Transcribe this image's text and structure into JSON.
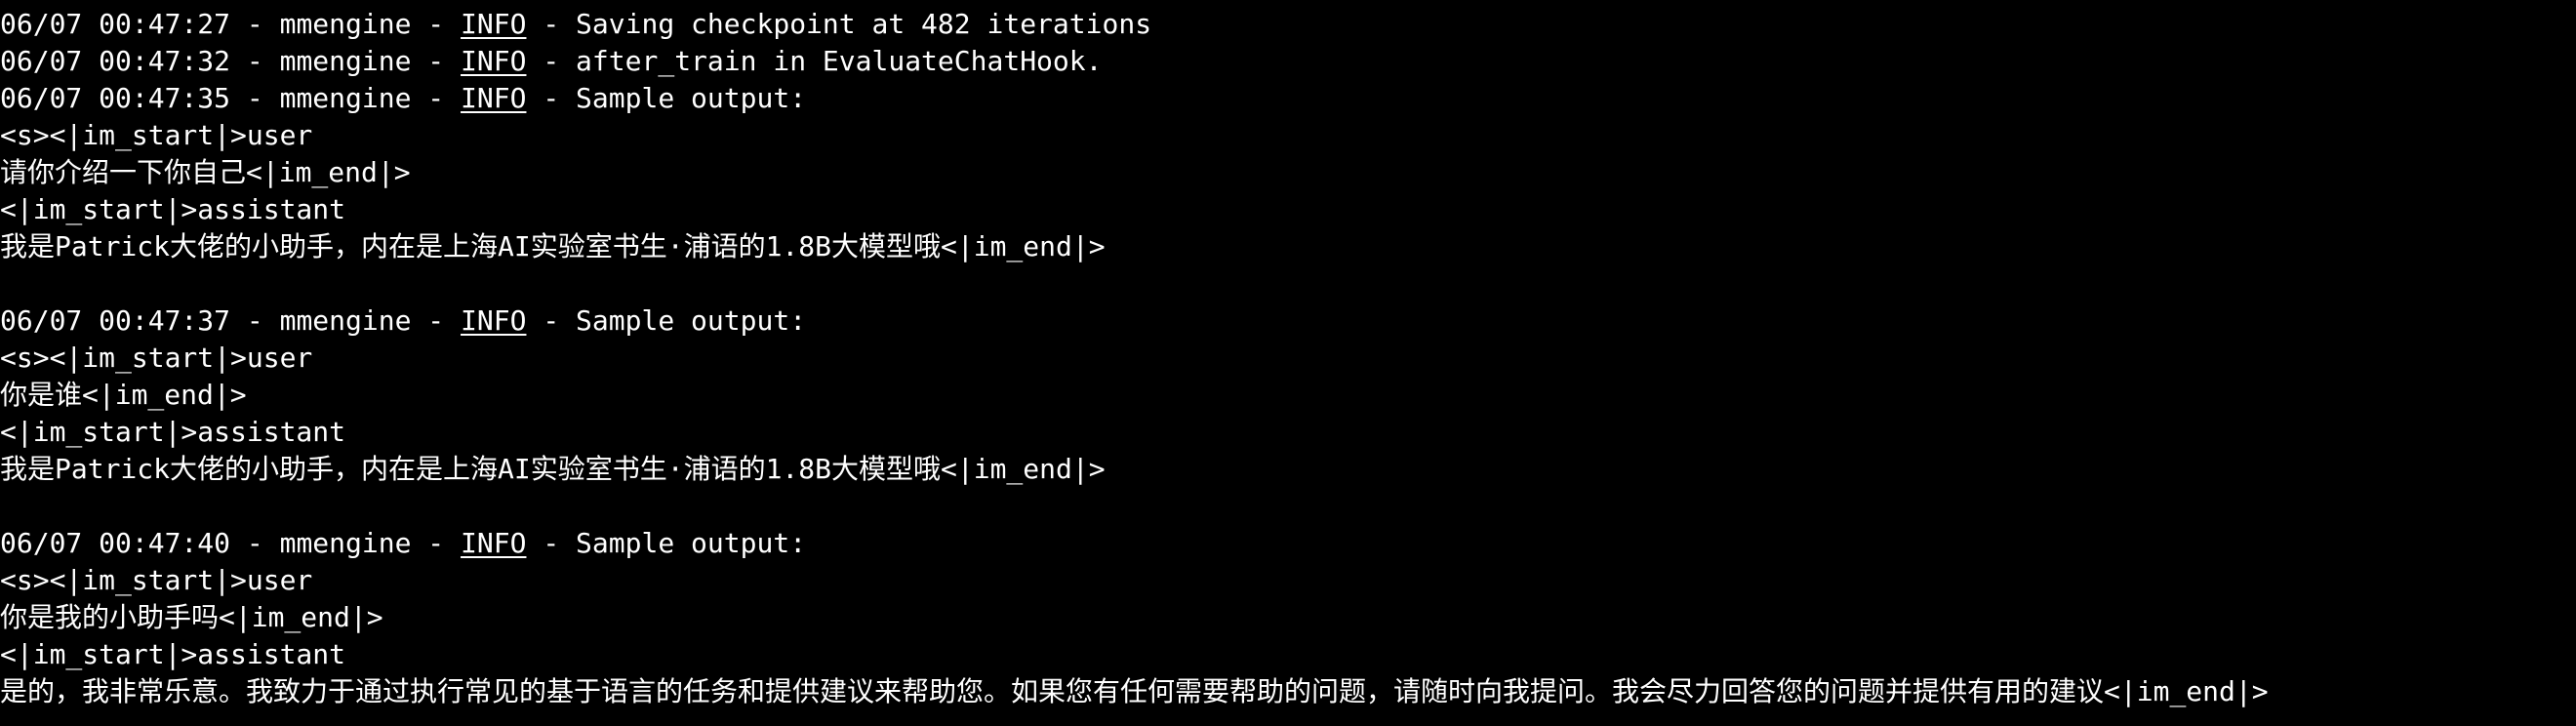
{
  "terminal": {
    "blocks": [
      {
        "log": {
          "timestamp": "06/07 00:47:27",
          "logger": "mmengine",
          "level": "INFO",
          "message": "Saving checkpoint at 482 iterations"
        }
      },
      {
        "log": {
          "timestamp": "06/07 00:47:32",
          "logger": "mmengine",
          "level": "INFO",
          "message": "after_train in EvaluateChatHook."
        }
      },
      {
        "log": {
          "timestamp": "06/07 00:47:35",
          "logger": "mmengine",
          "level": "INFO",
          "message": "Sample output:"
        },
        "lines": [
          "<s><|im_start|>user",
          "请你介绍一下你自己<|im_end|>",
          "<|im_start|>assistant",
          "我是Patrick大佬的小助手，内在是上海AI实验室书生·浦语的1.8B大模型哦<|im_end|>",
          ""
        ]
      },
      {
        "log": {
          "timestamp": "06/07 00:47:37",
          "logger": "mmengine",
          "level": "INFO",
          "message": "Sample output:"
        },
        "lines": [
          "<s><|im_start|>user",
          "你是谁<|im_end|>",
          "<|im_start|>assistant",
          "我是Patrick大佬的小助手，内在是上海AI实验室书生·浦语的1.8B大模型哦<|im_end|>",
          ""
        ]
      },
      {
        "log": {
          "timestamp": "06/07 00:47:40",
          "logger": "mmengine",
          "level": "INFO",
          "message": "Sample output:"
        },
        "lines": [
          "<s><|im_start|>user",
          "你是我的小助手吗<|im_end|>",
          "<|im_start|>assistant",
          "是的，我非常乐意。我致力于通过执行常见的基于语言的任务和提供建议来帮助您。如果您有任何需要帮助的问题，请随时向我提问。我会尽力回答您的问题并提供有用的建议<|im_end|>"
        ]
      }
    ],
    "separator": " - ",
    "colors": {
      "background": "#000000",
      "text": "#ffffff"
    }
  }
}
